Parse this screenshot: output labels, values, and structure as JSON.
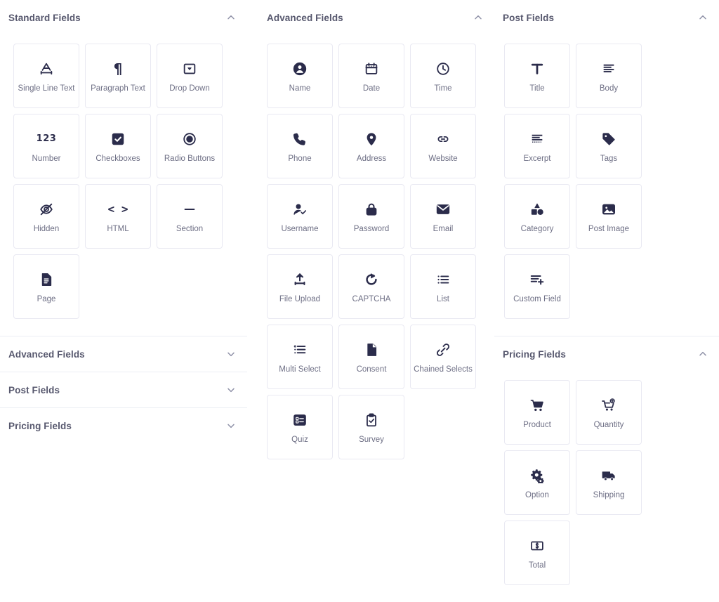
{
  "panels": [
    {
      "id": "standard-fields",
      "title": "Standard Fields",
      "column": 1,
      "expanded": true,
      "toggle_icon": "chevron-up-icon",
      "fields": [
        {
          "label": "Single Line Text",
          "icon": "single-line-text-icon"
        },
        {
          "label": "Paragraph Text",
          "icon": "paragraph-icon"
        },
        {
          "label": "Drop Down",
          "icon": "drop-down-icon"
        },
        {
          "label": "Number",
          "icon": "number-icon"
        },
        {
          "label": "Checkboxes",
          "icon": "checkbox-icon"
        },
        {
          "label": "Radio Buttons",
          "icon": "radio-button-icon"
        },
        {
          "label": "Hidden",
          "icon": "eye-off-icon"
        },
        {
          "label": "HTML",
          "icon": "code-icon"
        },
        {
          "label": "Section",
          "icon": "section-dash-icon"
        },
        {
          "label": "Page",
          "icon": "page-document-icon"
        }
      ]
    },
    {
      "id": "advanced-fields-collapsed",
      "title": "Advanced Fields",
      "column": 1,
      "expanded": false,
      "toggle_icon": "chevron-down-icon",
      "fields": []
    },
    {
      "id": "post-fields-collapsed",
      "title": "Post Fields",
      "column": 1,
      "expanded": false,
      "toggle_icon": "chevron-down-icon",
      "fields": []
    },
    {
      "id": "pricing-fields-collapsed",
      "title": "Pricing Fields",
      "column": 1,
      "expanded": false,
      "toggle_icon": "chevron-down-icon",
      "fields": []
    },
    {
      "id": "advanced-fields",
      "title": "Advanced Fields",
      "column": 2,
      "expanded": true,
      "toggle_icon": "chevron-up-icon",
      "fields": [
        {
          "label": "Name",
          "icon": "user-circle-icon"
        },
        {
          "label": "Date",
          "icon": "calendar-icon"
        },
        {
          "label": "Time",
          "icon": "clock-icon"
        },
        {
          "label": "Phone",
          "icon": "phone-icon"
        },
        {
          "label": "Address",
          "icon": "map-pin-icon"
        },
        {
          "label": "Website",
          "icon": "link-icon"
        },
        {
          "label": "Username",
          "icon": "user-check-icon"
        },
        {
          "label": "Password",
          "icon": "lock-icon"
        },
        {
          "label": "Email",
          "icon": "envelope-icon"
        },
        {
          "label": "File Upload",
          "icon": "upload-icon"
        },
        {
          "label": "CAPTCHA",
          "icon": "refresh-icon"
        },
        {
          "label": "List",
          "icon": "list-icon"
        },
        {
          "label": "Multi Select",
          "icon": "multi-select-icon"
        },
        {
          "label": "Consent",
          "icon": "document-icon"
        },
        {
          "label": "Chained Selects",
          "icon": "chain-link-icon"
        },
        {
          "label": "Quiz",
          "icon": "quiz-icon"
        },
        {
          "label": "Survey",
          "icon": "clipboard-check-icon"
        }
      ]
    },
    {
      "id": "post-fields",
      "title": "Post Fields",
      "column": 3,
      "expanded": true,
      "toggle_icon": "chevron-up-icon",
      "fields": [
        {
          "label": "Title",
          "icon": "title-t-icon"
        },
        {
          "label": "Body",
          "icon": "text-lines-icon"
        },
        {
          "label": "Excerpt",
          "icon": "excerpt-lines-icon"
        },
        {
          "label": "Tags",
          "icon": "tag-icon"
        },
        {
          "label": "Category",
          "icon": "shapes-icon"
        },
        {
          "label": "Post Image",
          "icon": "image-icon"
        },
        {
          "label": "Custom Field",
          "icon": "custom-field-plus-icon"
        }
      ]
    },
    {
      "id": "pricing-fields",
      "title": "Pricing Fields",
      "column": 3,
      "expanded": true,
      "toggle_icon": "chevron-up-icon",
      "fields": [
        {
          "label": "Product",
          "icon": "cart-icon"
        },
        {
          "label": "Quantity",
          "icon": "cart-quantity-icon"
        },
        {
          "label": "Option",
          "icon": "gears-icon"
        },
        {
          "label": "Shipping",
          "icon": "truck-icon"
        },
        {
          "label": "Total",
          "icon": "dollar-box-icon"
        }
      ]
    }
  ],
  "colors": {
    "icon": "#2b2c4b",
    "label": "#6e6f85",
    "title": "#57586e",
    "card_border": "#e9e9f2",
    "divider": "#eceef4",
    "chevron": "#8d8fa6",
    "background": "#ffffff"
  }
}
